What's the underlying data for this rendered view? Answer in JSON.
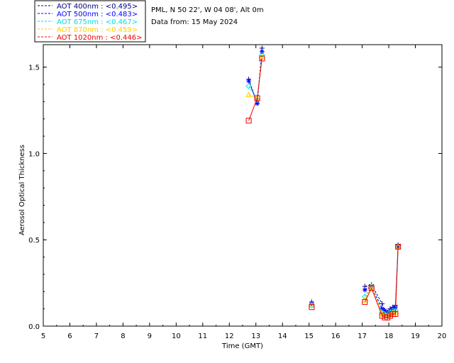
{
  "info": {
    "location": "PML, N 50 22', W 04 08', Alt 0m",
    "date_line": "Data from: 15 May 2024"
  },
  "chart_data": {
    "type": "scatter",
    "title": "",
    "xlabel": "Time (GMT)",
    "ylabel": "Aerosol Optical Thickness",
    "xlim": [
      5,
      20
    ],
    "ylim": [
      0,
      1.6
    ],
    "xticks": [
      5,
      6,
      7,
      8,
      9,
      10,
      11,
      12,
      13,
      14,
      15,
      16,
      17,
      18,
      19,
      20
    ],
    "yticks": [
      0.0,
      0.5,
      1.0,
      1.5
    ],
    "ytick_labels": [
      "0.0",
      "0.5",
      "1.0",
      "1.5"
    ],
    "grid": false,
    "legend_position": "top-left, outside plot",
    "series": [
      {
        "name": "AOT  400nm : <0.495>",
        "color": "#000080",
        "marker": "plus",
        "x": [
          12.73,
          13.05,
          13.23,
          15.1,
          17.1,
          17.35,
          17.75,
          17.85,
          17.95,
          18.05,
          18.15,
          18.25,
          18.35
        ],
        "y": [
          1.43,
          1.29,
          1.61,
          0.14,
          0.23,
          0.24,
          0.13,
          0.09,
          0.08,
          0.1,
          0.11,
          0.12,
          0.47
        ]
      },
      {
        "name": "AOT  500nm : <0.483>",
        "color": "#0000ff",
        "marker": "asterisk",
        "x": [
          12.73,
          13.05,
          13.23,
          15.1,
          17.1,
          17.35,
          17.75,
          17.85,
          17.95,
          18.05,
          18.15,
          18.25,
          18.35
        ],
        "y": [
          1.42,
          1.29,
          1.59,
          0.13,
          0.21,
          0.23,
          0.1,
          0.09,
          0.07,
          0.09,
          0.1,
          0.11,
          0.46
        ]
      },
      {
        "name": "AOT  675nm : <0.467>",
        "color": "#00dddd",
        "marker": "diamond",
        "x": [
          12.73,
          13.05,
          13.23,
          15.1,
          17.1,
          17.35,
          17.75,
          17.85,
          17.95,
          18.05,
          18.15,
          18.25,
          18.35
        ],
        "y": [
          1.39,
          1.31,
          1.57,
          0.12,
          0.17,
          0.23,
          0.08,
          0.07,
          0.06,
          0.08,
          0.09,
          0.09,
          0.46
        ]
      },
      {
        "name": "AOT  870nm : <0.459>",
        "color": "#ffcc00",
        "marker": "triangle",
        "x": [
          12.73,
          13.05,
          13.23,
          15.1,
          17.1,
          17.35,
          17.75,
          17.85,
          17.95,
          18.05,
          18.15,
          18.25,
          18.35
        ],
        "y": [
          1.34,
          1.32,
          1.56,
          0.12,
          0.15,
          0.23,
          0.07,
          0.06,
          0.06,
          0.07,
          0.08,
          0.08,
          0.46
        ]
      },
      {
        "name": "AOT 1020nm : <0.446>",
        "color": "#ee0000",
        "marker": "square",
        "x": [
          12.73,
          13.05,
          13.23,
          15.1,
          17.1,
          17.35,
          17.75,
          17.85,
          17.95,
          18.05,
          18.15,
          18.25,
          18.35
        ],
        "y": [
          1.19,
          1.32,
          1.55,
          0.11,
          0.14,
          0.22,
          0.06,
          0.05,
          0.05,
          0.06,
          0.07,
          0.07,
          0.46
        ]
      }
    ]
  }
}
